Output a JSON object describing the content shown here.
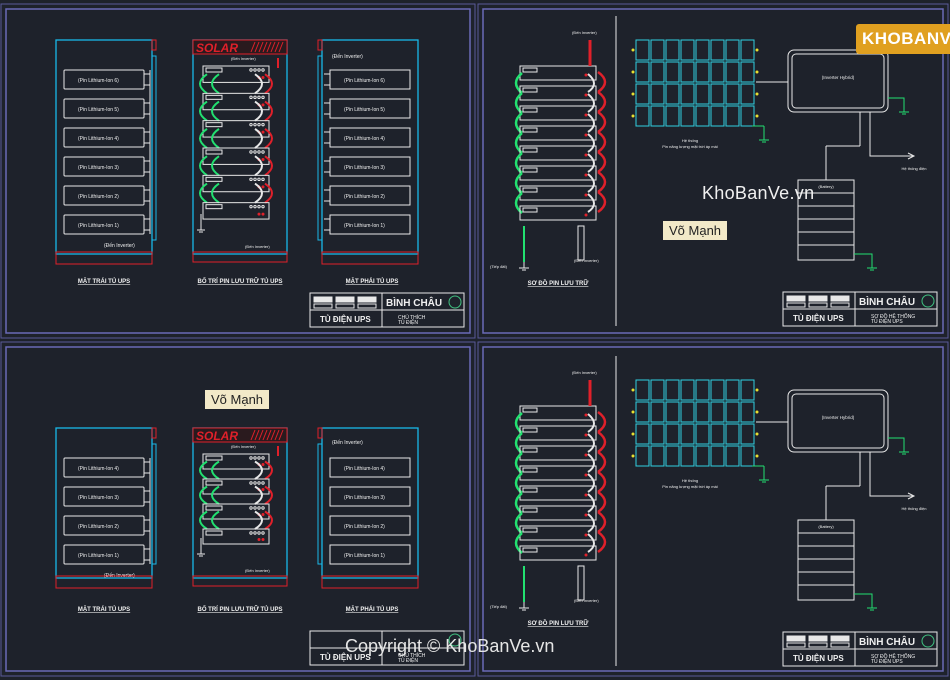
{
  "watermark": {
    "site": "KhoBanVe.vn",
    "copyright": "Copyright © KhoBanVe.vn",
    "logo_text": "KHOBANVE"
  },
  "stamp": "Võ Mạnh",
  "panels": {
    "top_left": {
      "left_view_title": "MẶT TRÁI TỦ UPS",
      "front_view_title": "BỐ TRÍ PIN LƯU TRỮ TỦ UPS",
      "right_view_title": "MẶT PHẢI TỦ UPS",
      "solar": "SOLAR",
      "battery_labels": [
        "(Pin Lithium-Ion 6)",
        "(Pin Lithium-Ion 5)",
        "(Pin Lithium-Ion 4)",
        "(Pin Lithium-Ion 3)",
        "(Pin Lithium-Ion 2)",
        "(Pin Lithium-Ion 1)"
      ],
      "inverter_note": "(Đến Inverter)",
      "title_block": {
        "company": "BÌNH CHÂU",
        "drawing": "TỦ ĐIỆN UPS",
        "note": "CHÚ THÍCH",
        "note2": "TỦ ĐIỆN"
      }
    },
    "top_right": {
      "diagram_title": "SƠ ĐỒ PIN LƯU TRỮ",
      "to_inverter": "(Đến Inverter)",
      "ground": "(Tiếp đất)",
      "pv_label": "Hệ thống",
      "pv_label2": "Pin năng lượng mặt trời áp mái",
      "inverter": "(Inverter Hybrid)",
      "battery": "(Battery)",
      "grid": "Hệ thống điện",
      "title_block": {
        "company": "BÌNH CHÂU",
        "drawing": "TỦ ĐIỆN UPS",
        "note": "SƠ ĐỒ HỆ THỐNG",
        "note2": "TỦ ĐIỆN UPS"
      }
    },
    "bottom_left": {
      "left_view_title": "MẶT TRÁI TỦ UPS",
      "front_view_title": "BỐ TRÍ PIN LƯU TRỮ TỦ UPS",
      "right_view_title": "MẶT PHẢI TỦ UPS",
      "solar": "SOLAR",
      "battery_labels": [
        "(Pin Lithium-Ion 4)",
        "(Pin Lithium-Ion 3)",
        "(Pin Lithium-Ion 2)",
        "(Pin Lithium-Ion 1)"
      ],
      "inverter_note": "(Đến Inverter)",
      "title_block": {
        "drawing": "TỦ ĐIỆN UPS",
        "note": "CHÚ THÍCH",
        "note2": "TỦ ĐIỆN"
      }
    },
    "bottom_right": {
      "diagram_title": "SƠ ĐỒ PIN LƯU TRỮ",
      "to_inverter": "(Đến Inverter)",
      "ground": "(Tiếp đất)",
      "pv_label": "Hệ thống",
      "pv_label2": "Pin năng lượng mặt trời áp mái",
      "inverter": "(Inverter Hybrid)",
      "battery": "(Battery)",
      "grid": "Hệ thống điện",
      "title_block": {
        "company": "BÌNH CHÂU",
        "drawing": "TỦ ĐIỆN UPS",
        "note": "SƠ ĐỒ HỆ THỐNG",
        "note2": "TỦ ĐIỆN UPS"
      }
    }
  },
  "colors": {
    "frame": "#6a6ab8",
    "cabinet": "#19b8e8",
    "red": "#e0202a",
    "green": "#22e070",
    "white": "#e8e8e8",
    "yellow": "#e8e030",
    "pv": "#30d0e0"
  }
}
